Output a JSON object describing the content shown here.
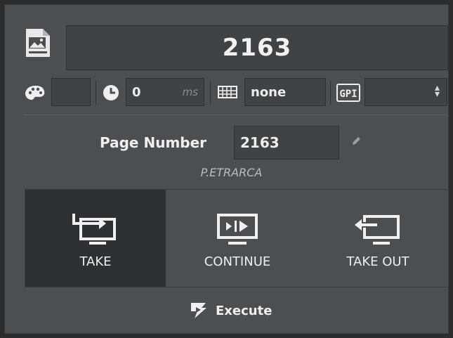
{
  "header": {
    "value": "2163",
    "page_icon": "image-document-icon"
  },
  "toolbar": {
    "palette_icon": "palette-icon",
    "timer_icon": "clock-icon",
    "duration_value": "0",
    "duration_unit": "ms",
    "grid_icon": "grid-icon",
    "mode_value": "none",
    "gpi_label": "GPI",
    "gpi_value": ""
  },
  "page_number": {
    "label": "Page Number",
    "value": "2163",
    "edit_icon": "pencil-icon"
  },
  "author": "P.ETRARCA",
  "actions": [
    {
      "label": "TAKE",
      "icon": "take-icon",
      "active": true
    },
    {
      "label": "CONTINUE",
      "icon": "continue-icon",
      "active": false
    },
    {
      "label": "TAKE OUT",
      "icon": "take-out-icon",
      "active": false
    }
  ],
  "execute": {
    "label": "Execute",
    "icon": "execute-icon"
  }
}
